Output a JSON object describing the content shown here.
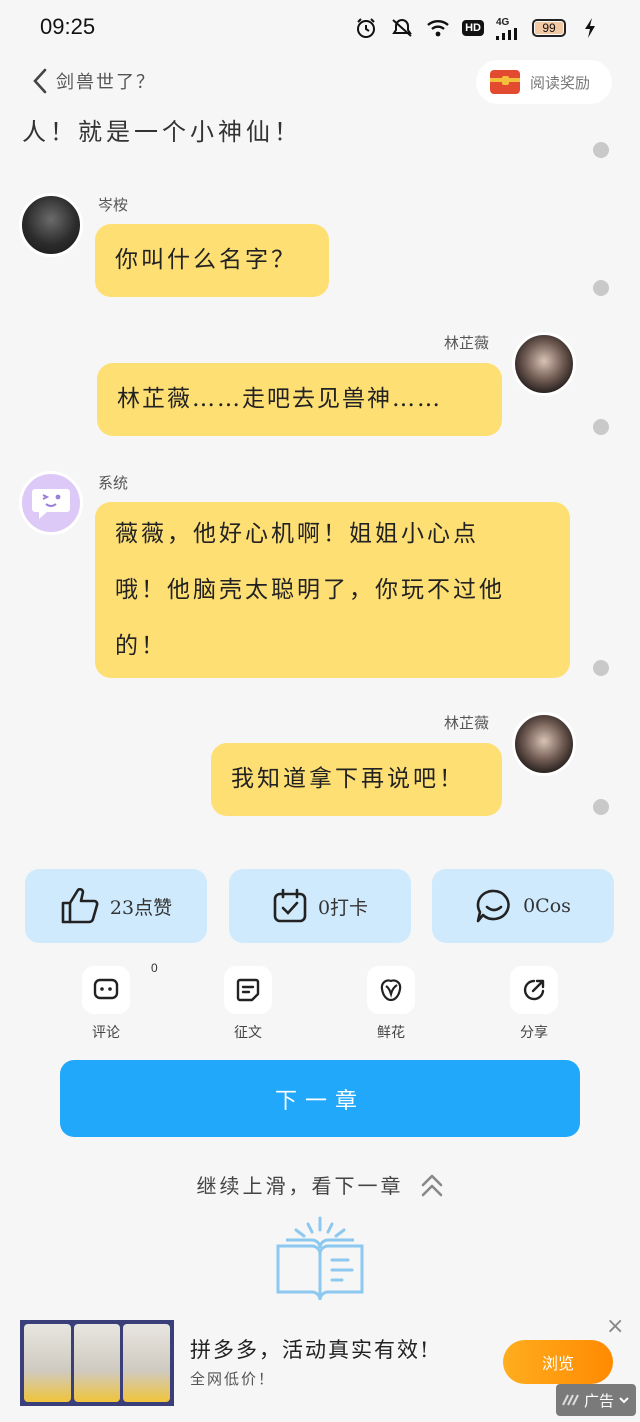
{
  "status_bar": {
    "time": "09:25",
    "network": "4G",
    "hd": "HD",
    "battery": "99",
    "battery_level": 0.99
  },
  "header": {
    "back_title": "剑兽世了？",
    "reward_label": "阅读奖励"
  },
  "prev_text": "人！就是一个小神仙！",
  "messages": [
    {
      "sender": "岑桉",
      "text": "你叫什么名字？"
    },
    {
      "sender": "林芷薇",
      "text": "林芷薇……走吧去见兽神……"
    },
    {
      "sender": "系统",
      "lines": [
        "薇薇，他好心机啊！姐姐小心点",
        "哦！他脑壳太聪明了，你玩不过他",
        "的！"
      ]
    },
    {
      "sender": "林芷薇",
      "text": "我知道拿下再说吧！"
    }
  ],
  "actions": {
    "like": "23点赞",
    "checkin": "0打卡",
    "cos": "0Cos"
  },
  "tools": {
    "comment": "评论",
    "comment_count": "0",
    "essay": "征文",
    "flower": "鲜花",
    "share": "分享"
  },
  "next_chapter": "下一章",
  "swipe_hint": "继续上滑，看下一章",
  "ad": {
    "title": "拼多多，活动真实有效!",
    "subtitle": "全网低价！",
    "browse": "浏览",
    "badge": "广告",
    "close": "×"
  },
  "colors": {
    "bubble": "#fedf74",
    "action_bg": "#cfeafc",
    "next_button": "#22a8fa",
    "ad_button": "#ff9a10"
  }
}
